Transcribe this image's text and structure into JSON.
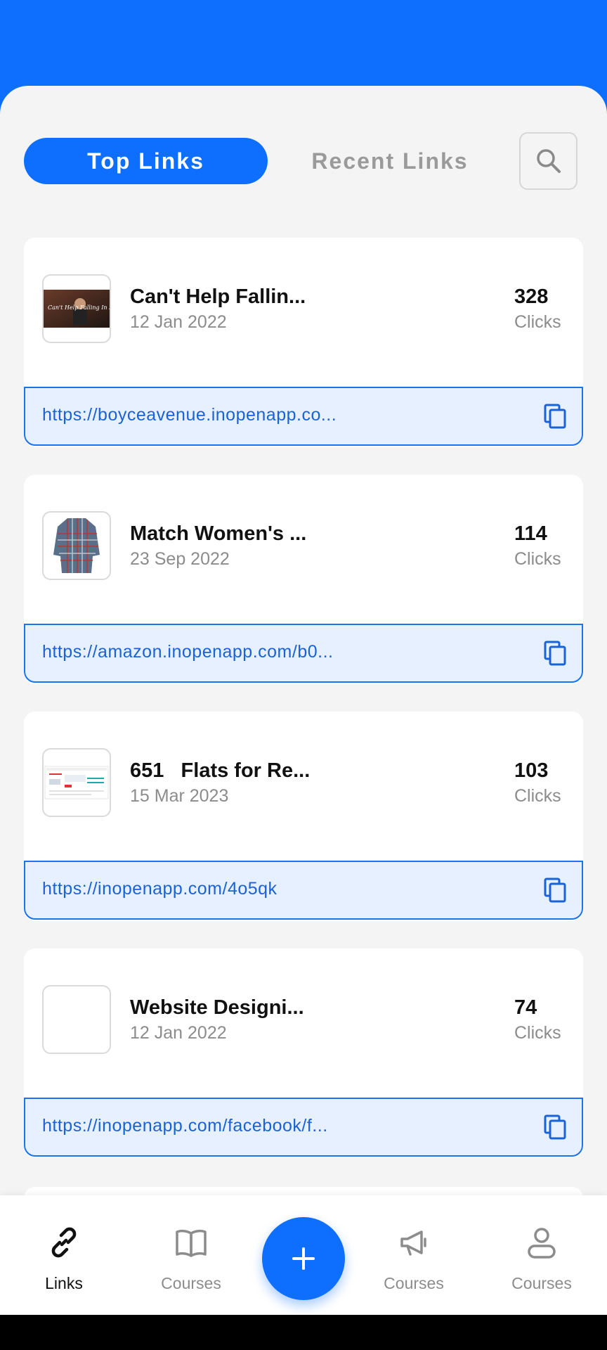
{
  "tabs": {
    "top": "Top Links",
    "recent": "Recent Links"
  },
  "links": [
    {
      "title": "Can't Help Fallin...",
      "date": "12 Jan 2022",
      "clicks": "328",
      "clicks_label": "Clicks",
      "url": "https://boyceavenue.inopenapp.co...",
      "thumb": "video-cover-image",
      "thumb_text": "Can't Help Falling In Love"
    },
    {
      "title": "Match Women's ...",
      "date": "23 Sep 2022",
      "clicks": "114",
      "clicks_label": "Clicks",
      "url": "https://amazon.inopenapp.com/b0...",
      "thumb": "plaid-shirt-image"
    },
    {
      "title": "651   Flats for Re...",
      "date": "15 Mar 2023",
      "clicks": "103",
      "clicks_label": "Clicks",
      "url": "https://inopenapp.com/4o5qk",
      "thumb": "website-screenshot-image"
    },
    {
      "title": "Website Designi...",
      "date": "12 Jan 2022",
      "clicks": "74",
      "clicks_label": "Clicks",
      "url": "https://inopenapp.com/facebook/f...",
      "thumb": "empty-image"
    }
  ],
  "nav": {
    "links": "Links",
    "courses1": "Courses",
    "courses2": "Courses",
    "courses3": "Courses"
  },
  "colors": {
    "accent": "#0E6FFF",
    "url_bg": "#E6F0FE",
    "background": "#F4F4F4"
  }
}
